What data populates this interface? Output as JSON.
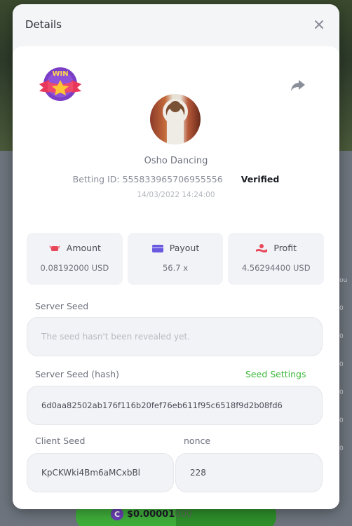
{
  "modal": {
    "title": "Details"
  },
  "bet": {
    "game_name": "Osho Dancing",
    "betting_id_label": "Betting ID:",
    "betting_id": "555833965706955556",
    "status": "Verified",
    "datetime": "14/03/2022 14:24:00",
    "badge_text": "WIN"
  },
  "stats": [
    {
      "label": "Amount",
      "value": "0.08192000 USD",
      "icon": "money-wings-icon",
      "color": "#e8475a"
    },
    {
      "label": "Payout",
      "value": "56.7 x",
      "icon": "wallet-card-icon",
      "color": "#6a5ae0"
    },
    {
      "label": "Profit",
      "value": "4.56294400 USD",
      "icon": "money-hand-icon",
      "color": "#e8475a"
    }
  ],
  "seeds": {
    "server_seed_label": "Server Seed",
    "server_seed_placeholder": "The seed hasn't been revealed yet.",
    "server_seed_hash_label": "Server Seed (hash)",
    "seed_settings_label": "Seed Settings",
    "server_seed_hash": "6d0aa82502ab176f116b20fef76eb611f95c6518f9d2b08fd6",
    "client_seed_label": "Client Seed",
    "client_seed": "KpCKWki4Bm6aMCxbBl",
    "nonce_label": "nonce",
    "nonce": "228"
  },
  "background": {
    "bet_amount": "$0.00001",
    "bet_amount_dim": "000",
    "coin_symbol": "C",
    "side_text": [
      "ou",
      "0",
      "0",
      "0",
      "0",
      "0",
      "0"
    ]
  },
  "colors": {
    "accent_green": "#3cb83a",
    "badge_purple": "#7a3fc6",
    "badge_ribbon": "#e8375a"
  }
}
